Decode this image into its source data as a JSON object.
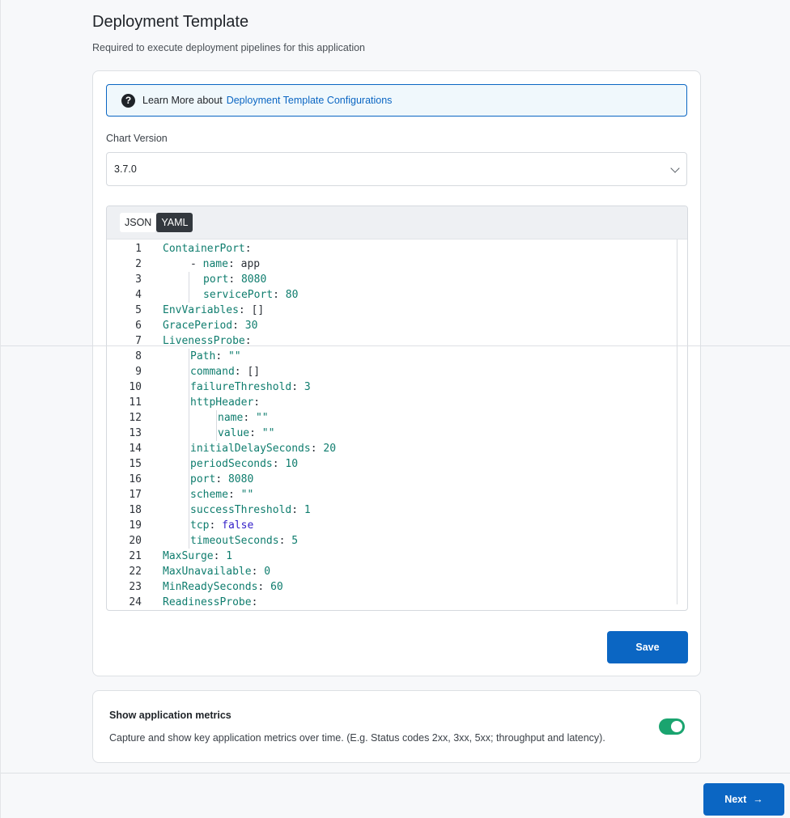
{
  "header": {
    "title": "Deployment Template",
    "subtitle": "Required to execute deployment pipelines for this application"
  },
  "info": {
    "icon": "question-circle-icon",
    "text": "Learn More about",
    "link": "Deployment Template Configurations"
  },
  "chart_version": {
    "label": "Chart Version",
    "value": "3.7.0"
  },
  "editor": {
    "tabs": [
      "JSON",
      "YAML"
    ],
    "active_tab": "YAML",
    "lines": [
      {
        "n": "1",
        "indent": 0,
        "key": "ContainerPort",
        "sep": ":",
        "val": "",
        "type": ""
      },
      {
        "n": "2",
        "indent": 1,
        "key": "- name",
        "sep": ": ",
        "val": "app",
        "type": "p"
      },
      {
        "n": "3",
        "indent": 2,
        "key": "port",
        "sep": ": ",
        "val": "8080",
        "type": "v"
      },
      {
        "n": "4",
        "indent": 2,
        "key": "servicePort",
        "sep": ": ",
        "val": "80",
        "type": "v"
      },
      {
        "n": "5",
        "indent": 0,
        "key": "EnvVariables",
        "sep": ": ",
        "val": "[]",
        "type": "p"
      },
      {
        "n": "6",
        "indent": 0,
        "key": "GracePeriod",
        "sep": ": ",
        "val": "30",
        "type": "v"
      },
      {
        "n": "7",
        "indent": 0,
        "key": "LivenessProbe",
        "sep": ":",
        "val": "",
        "type": ""
      },
      {
        "n": "8",
        "indent": 1,
        "key": "Path",
        "sep": ": ",
        "val": "\"\"",
        "type": "s"
      },
      {
        "n": "9",
        "indent": 1,
        "key": "command",
        "sep": ": ",
        "val": "[]",
        "type": "p"
      },
      {
        "n": "10",
        "indent": 1,
        "key": "failureThreshold",
        "sep": ": ",
        "val": "3",
        "type": "v"
      },
      {
        "n": "11",
        "indent": 1,
        "key": "httpHeader",
        "sep": ":",
        "val": "",
        "type": ""
      },
      {
        "n": "12",
        "indent": 3,
        "key": "name",
        "sep": ": ",
        "val": "\"\"",
        "type": "s"
      },
      {
        "n": "13",
        "indent": 3,
        "key": "value",
        "sep": ": ",
        "val": "\"\"",
        "type": "s"
      },
      {
        "n": "14",
        "indent": 1,
        "key": "initialDelaySeconds",
        "sep": ": ",
        "val": "20",
        "type": "v"
      },
      {
        "n": "15",
        "indent": 1,
        "key": "periodSeconds",
        "sep": ": ",
        "val": "10",
        "type": "v"
      },
      {
        "n": "16",
        "indent": 1,
        "key": "port",
        "sep": ": ",
        "val": "8080",
        "type": "v"
      },
      {
        "n": "17",
        "indent": 1,
        "key": "scheme",
        "sep": ": ",
        "val": "\"\"",
        "type": "s"
      },
      {
        "n": "18",
        "indent": 1,
        "key": "successThreshold",
        "sep": ": ",
        "val": "1",
        "type": "v"
      },
      {
        "n": "19",
        "indent": 1,
        "key": "tcp",
        "sep": ": ",
        "val": "false",
        "type": "b"
      },
      {
        "n": "20",
        "indent": 1,
        "key": "timeoutSeconds",
        "sep": ": ",
        "val": "5",
        "type": "v"
      },
      {
        "n": "21",
        "indent": 0,
        "key": "MaxSurge",
        "sep": ": ",
        "val": "1",
        "type": "v"
      },
      {
        "n": "22",
        "indent": 0,
        "key": "MaxUnavailable",
        "sep": ": ",
        "val": "0",
        "type": "v"
      },
      {
        "n": "23",
        "indent": 0,
        "key": "MinReadySeconds",
        "sep": ": ",
        "val": "60",
        "type": "v"
      },
      {
        "n": "24",
        "indent": 0,
        "key": "ReadinessProbe",
        "sep": ":",
        "val": "",
        "type": ""
      }
    ]
  },
  "save_label": "Save",
  "metrics": {
    "title": "Show application metrics",
    "description": "Capture and show key application metrics over time. (E.g. Status codes 2xx, 3xx, 5xx; throughput and latency).",
    "enabled": true
  },
  "footer": {
    "next_label": "Next",
    "next_icon": "arrow-right-icon"
  },
  "colors": {
    "primary": "#0b66c3",
    "toggle_on": "#1aa46f",
    "yaml_key": "#0f7d6e",
    "yaml_bool": "#3421c9"
  }
}
